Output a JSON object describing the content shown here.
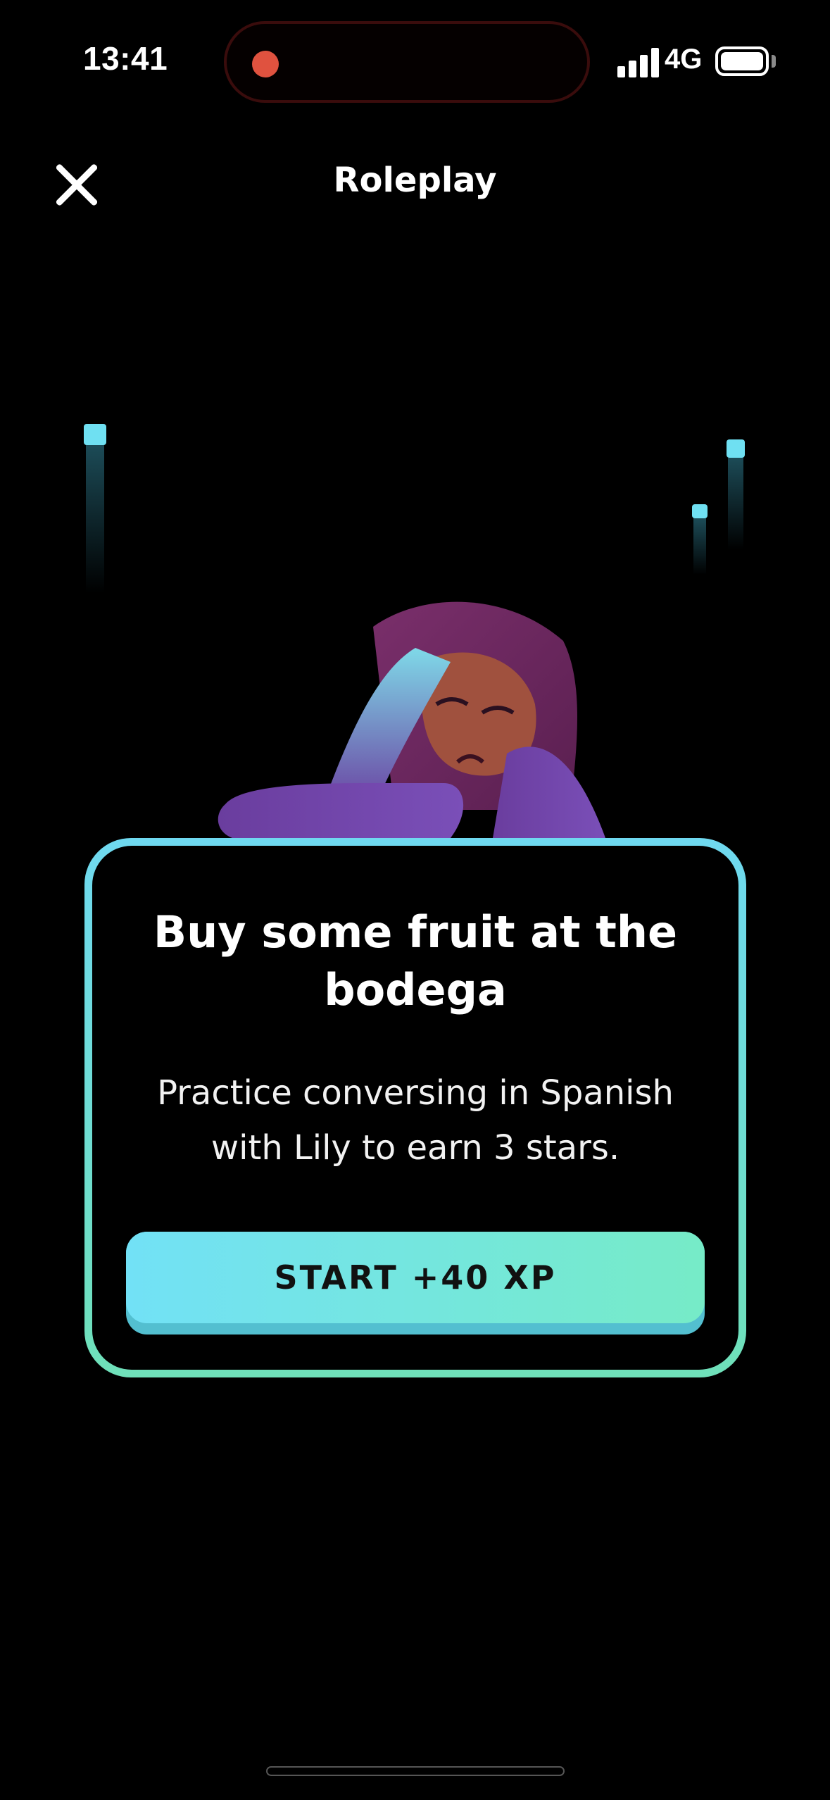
{
  "status_bar": {
    "time": "13:41",
    "network": "4G",
    "recording_color": "#e0523f"
  },
  "header": {
    "title": "Roleplay",
    "close_icon": "close-icon"
  },
  "illustration": {
    "character": "Lily"
  },
  "card": {
    "title": "Buy some fruit at the bodega",
    "description": "Practice conversing in Spanish with Lily to earn 3 stars.",
    "start_label": "START +40 XP",
    "accent_top": "#6fd9f0",
    "accent_bottom": "#6fe0b9"
  }
}
